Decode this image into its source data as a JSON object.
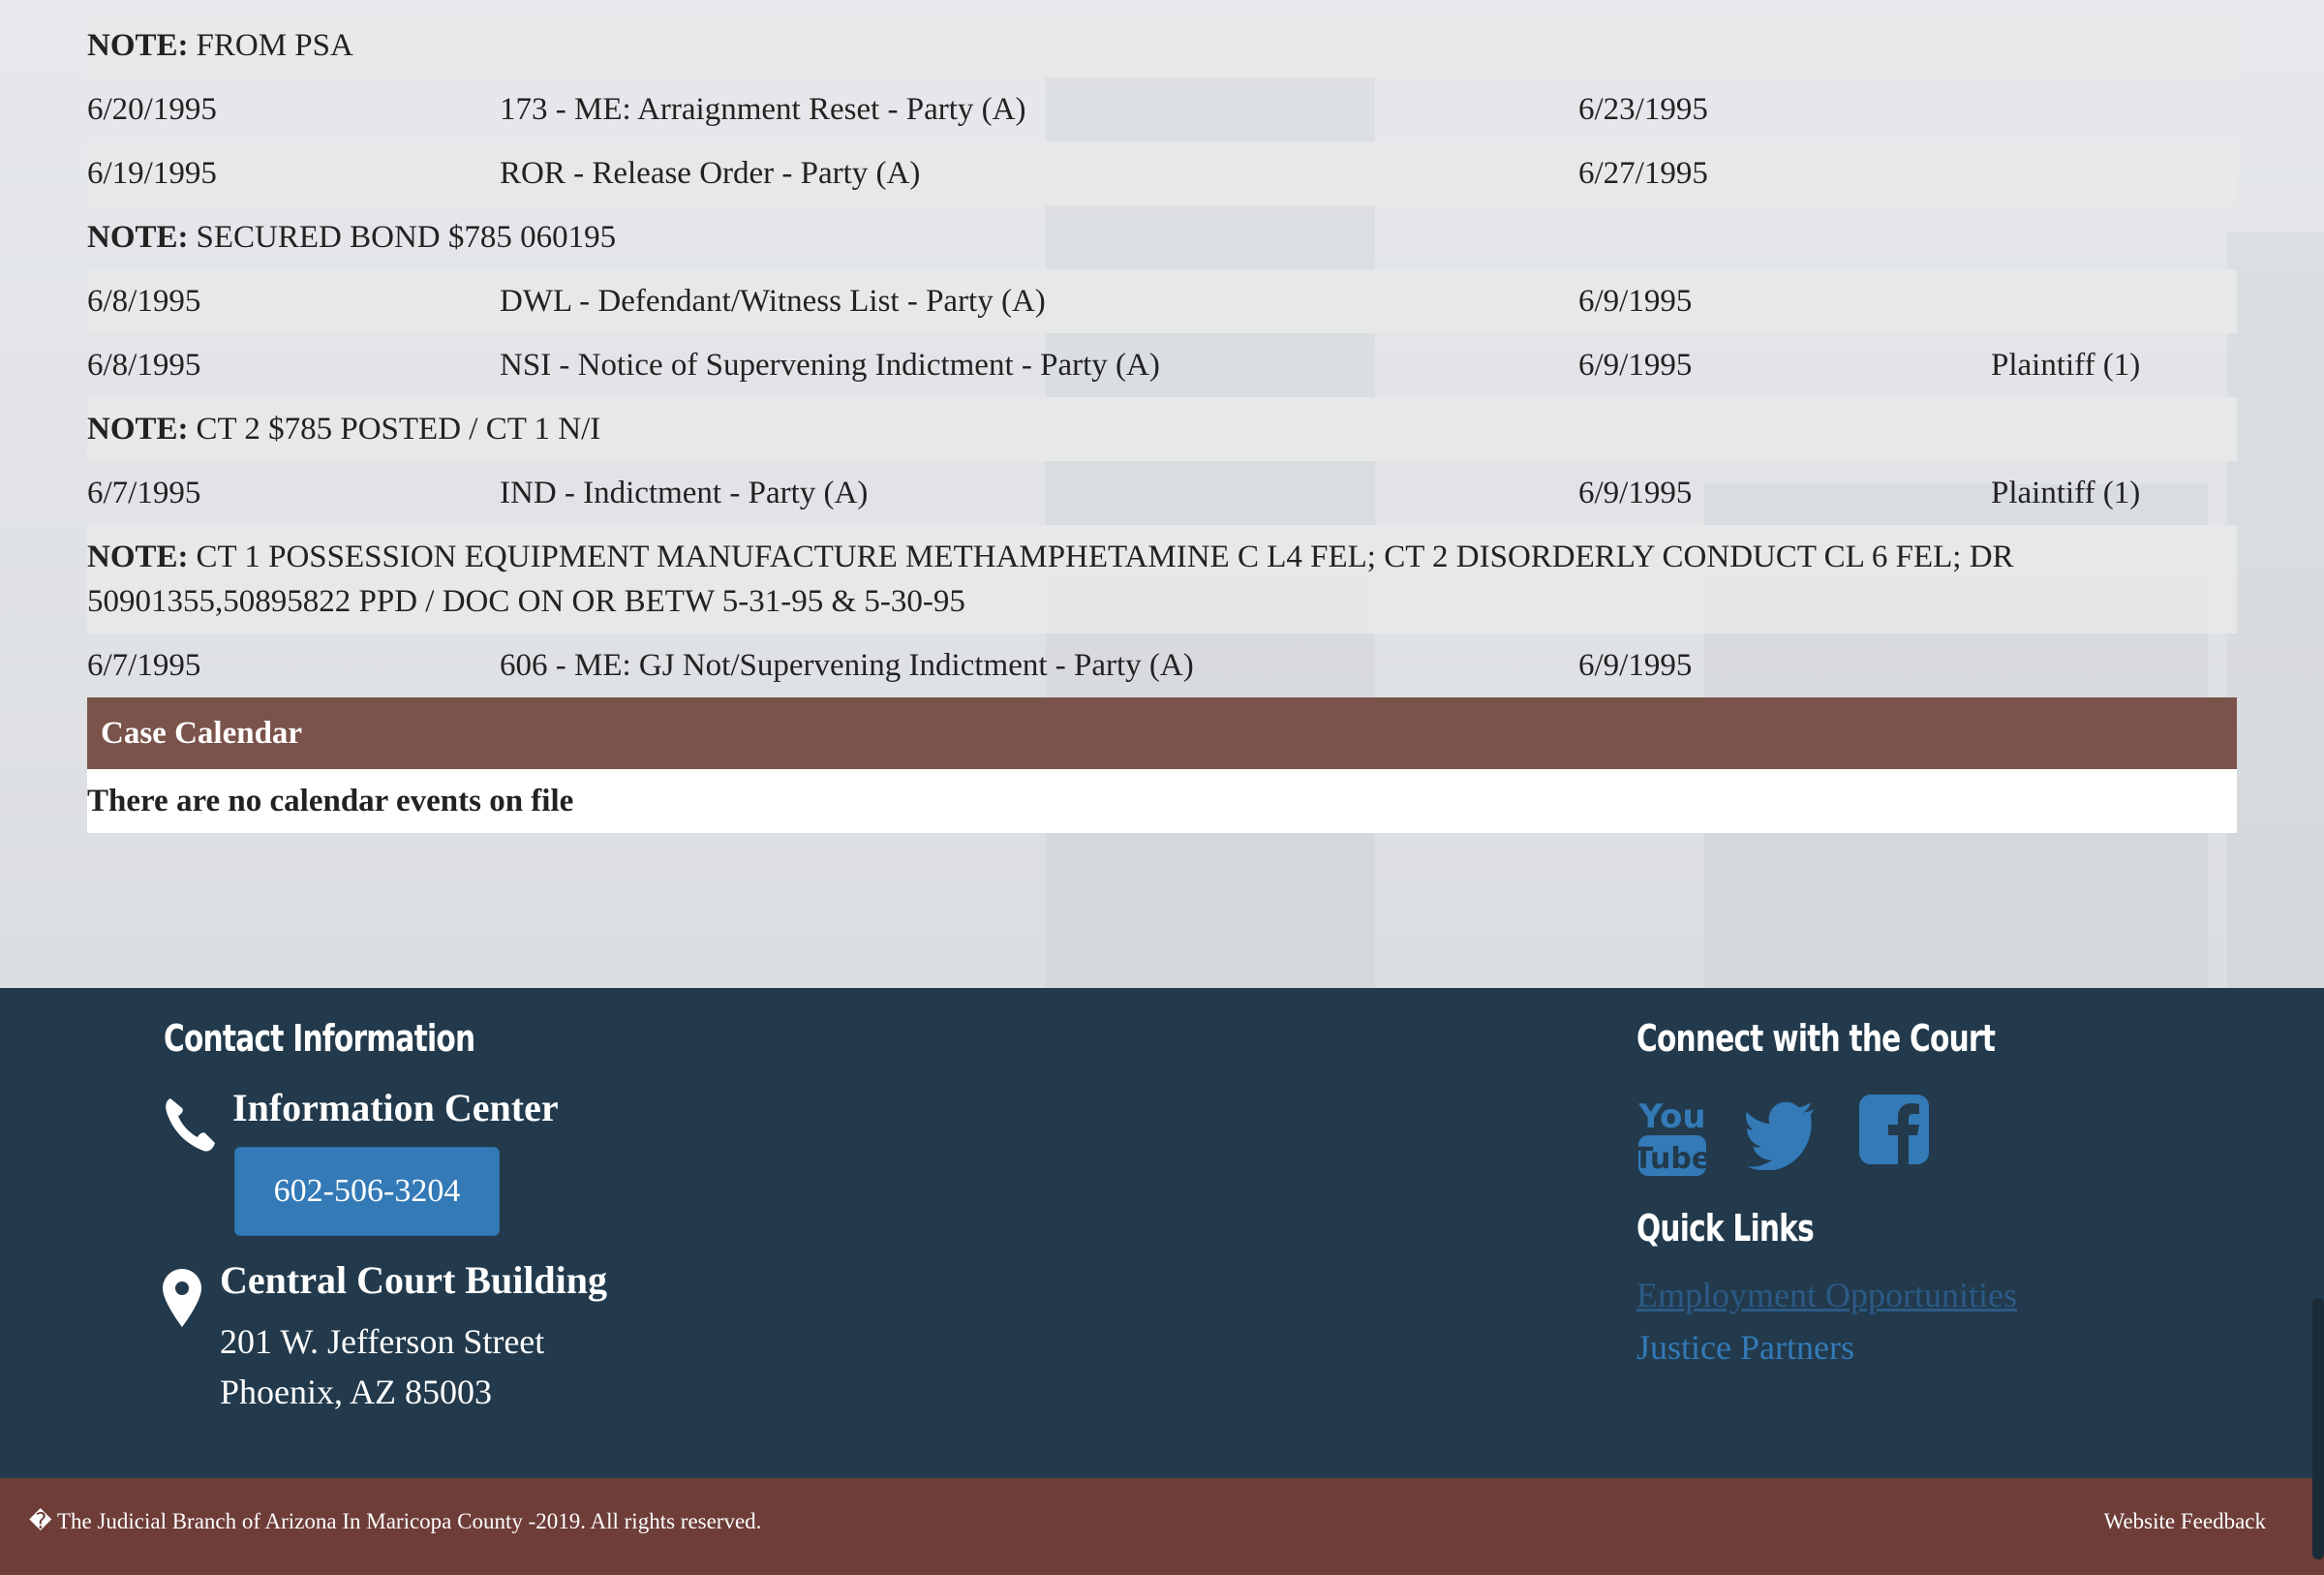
{
  "docket": [
    {
      "type": "note",
      "label": "NOTE:",
      "text": "FROM PSA",
      "shade": true
    },
    {
      "type": "row",
      "date": "6/20/1995",
      "description": "173 - ME: Arraignment Reset - Party (A)",
      "filed": "6/23/1995",
      "party": "",
      "shade": false
    },
    {
      "type": "row",
      "date": "6/19/1995",
      "description": "ROR - Release Order - Party (A)",
      "filed": "6/27/1995",
      "party": "",
      "shade": true
    },
    {
      "type": "note",
      "label": "NOTE:",
      "text": "SECURED BOND $785 060195",
      "shade": false
    },
    {
      "type": "row",
      "date": "6/8/1995",
      "description": "DWL - Defendant/Witness List - Party (A)",
      "filed": "6/9/1995",
      "party": "",
      "shade": true
    },
    {
      "type": "row",
      "date": "6/8/1995",
      "description": "NSI - Notice of Supervening Indictment - Party (A)",
      "filed": "6/9/1995",
      "party": "Plaintiff (1)",
      "shade": false
    },
    {
      "type": "note",
      "label": "NOTE:",
      "text": "CT 2 $785 POSTED / CT 1 N/I",
      "shade": true
    },
    {
      "type": "row",
      "date": "6/7/1995",
      "description": "IND - Indictment - Party (A)",
      "filed": "6/9/1995",
      "party": "Plaintiff (1)",
      "shade": false
    },
    {
      "type": "note",
      "label": "NOTE:",
      "text": "CT 1 POSSESSION EQUIPMENT MANUFACTURE METHAMPHETAMINE C L4 FEL; CT 2 DISORDERLY CONDUCT CL 6 FEL; DR 50901355,50895822 PPD / DOC ON OR BETW 5-31-95 & 5-30-95",
      "shade": true,
      "tall": true
    },
    {
      "type": "row",
      "date": "6/7/1995",
      "description": "606 - ME: GJ Not/Supervening Indictment - Party (A)",
      "filed": "6/9/1995",
      "party": "",
      "shade": false
    }
  ],
  "calendar": {
    "title": "Case Calendar",
    "empty_message": "There are no calendar events on file"
  },
  "footer": {
    "contact_title": "Contact Information",
    "info_center": "Information Center",
    "phone": "602-506-3204",
    "building": "Central Court Building",
    "address_line1": "201 W. Jefferson Street",
    "address_line2": "Phoenix, AZ 85003",
    "connect_title": "Connect with the Court",
    "social": [
      "youtube-icon",
      "twitter-icon",
      "facebook-icon"
    ],
    "quick_links_title": "Quick Links",
    "links": [
      "Employment Opportunities",
      "Justice Partners"
    ]
  },
  "bottom_bar": {
    "copyright": "� The Judicial Branch of Arizona In Maricopa County -2019. All rights reserved.",
    "feedback": "Website Feedback"
  },
  "colors": {
    "calendar_header": "#7a534a",
    "footer_bg": "#223a4c",
    "bottom_bar_bg": "#6e3d38",
    "button_blue": "#337ab7"
  }
}
